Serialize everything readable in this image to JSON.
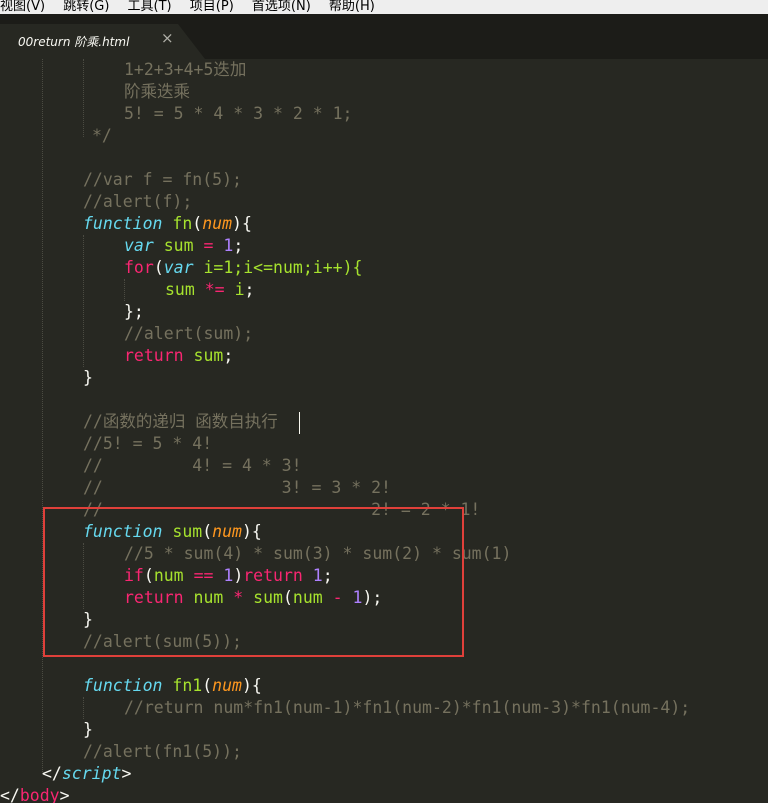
{
  "menu": [
    "视图(V)",
    "跳转(G)",
    "工具(T)",
    "项目(P)",
    "首选项(N)",
    "帮助(H)"
  ],
  "tab": {
    "title": "00return 阶乘.html",
    "close": "×"
  },
  "code": {
    "l1": "1+2+3+4+5迭加",
    "l2": "阶乘迭乘",
    "l3": "5! = 5 * 4 * 3 * 2 * 1;",
    "l4": "*/",
    "l5": "//var f = fn(5);",
    "l6": "//alert(f);",
    "l7": {
      "kw": "function",
      "name": "fn",
      "p1": "(",
      "param": "num",
      "p2": "){"
    },
    "l8": {
      "kw": "var",
      "id": "sum",
      "op": "=",
      "num": "1",
      "semi": ";"
    },
    "l9": {
      "ctrl": "for",
      "p1": "(",
      "kw": "var",
      "rest": "i=1;i<=num;i++){"
    },
    "l10": {
      "id": "sum",
      "op": "*=",
      "var": "i",
      "semi": ";"
    },
    "l11": "};",
    "l12": "//alert(sum);",
    "l13": {
      "ctrl": "return",
      "id": "sum",
      "semi": ";"
    },
    "l14": "}",
    "l15": "//函数的递归 函数自执行",
    "l16": "//5! = 5 * 4!",
    "l17": "//         4! = 4 * 3!",
    "l18": "//                  3! = 3 * 2!",
    "l19": "//                           2! = 2 * 1!",
    "l20": {
      "kw": "function",
      "name": "sum",
      "p1": "(",
      "param": "num",
      "p2": "){"
    },
    "l21": "//5 * sum(4) * sum(3) * sum(2) * sum(1)",
    "l22": {
      "ctrl": "if",
      "p1": "(",
      "id": "num",
      "op": "==",
      "num": "1",
      "p2": ")",
      "ret": "return",
      "num2": "1",
      "semi": ";"
    },
    "l23": {
      "ctrl": "return",
      "id": "num",
      "op": "*",
      "call": "sum",
      "p1": "(",
      "id2": "num",
      "op2": "-",
      "num": "1",
      "p2": ");"
    },
    "l24": "}",
    "l25": "//alert(sum(5));",
    "l26": {
      "kw": "function",
      "name": "fn1",
      "p1": "(",
      "param": "num",
      "p2": "){"
    },
    "l27": "//return num*fn1(num-1)*fn1(num-2)*fn1(num-3)*fn1(num-4);",
    "l28": "}",
    "l29": "//alert(fn1(5));",
    "l30": {
      "open": "</",
      "tag": "script",
      "close": ">"
    },
    "l31": {
      "open": "</",
      "tag": "body",
      "close": ">"
    }
  }
}
